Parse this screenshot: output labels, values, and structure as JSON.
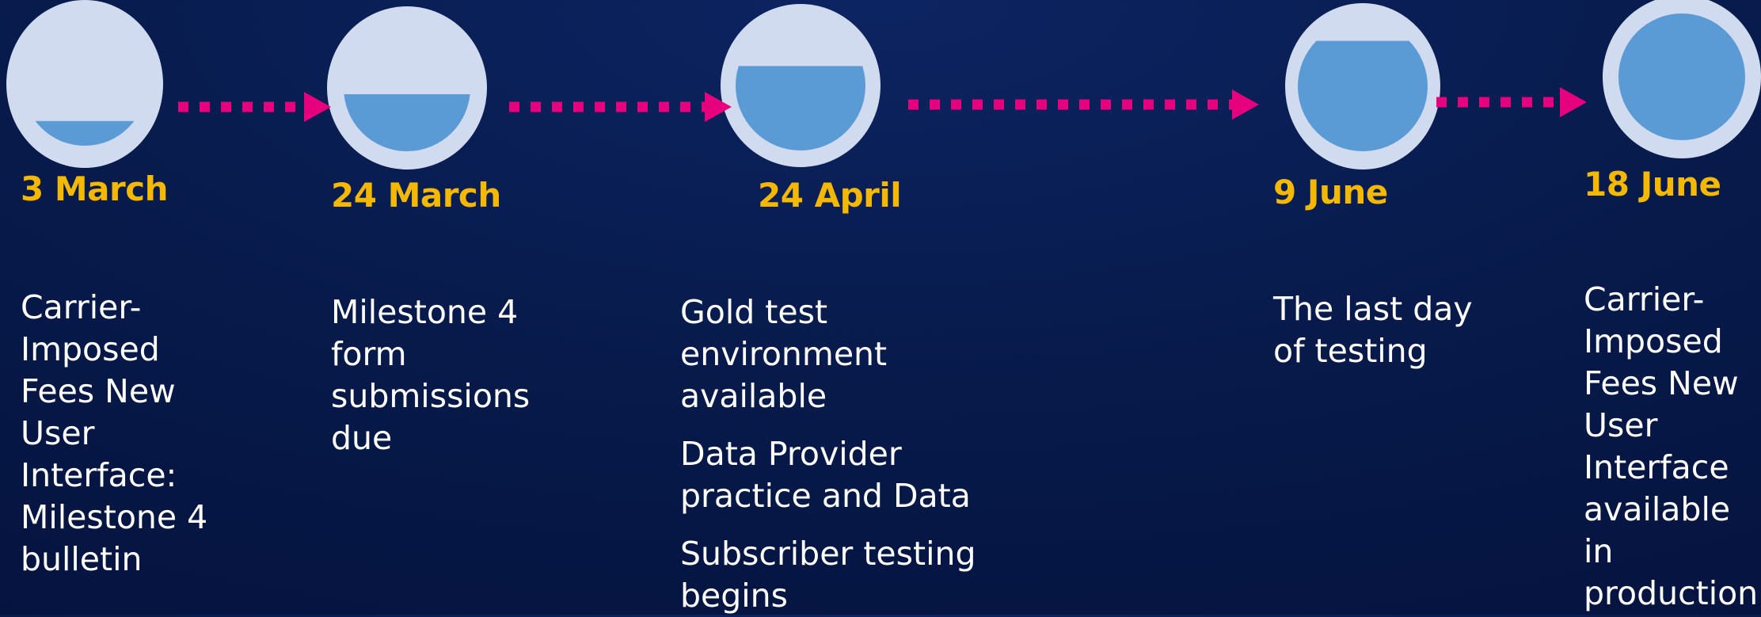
{
  "colors": {
    "background": "#06164a",
    "circle_outer": "#d1dbef",
    "circle_fill": "#5b9bd5",
    "arrow": "#e6007e",
    "date_text": "#f5b800",
    "desc_text": "#ffffff"
  },
  "milestones": [
    {
      "date": "3 March",
      "fill_fraction": 0.2,
      "description": [
        "Carrier-Imposed Fees New User Interface: Milestone 4 bulletin"
      ]
    },
    {
      "date": "24 March",
      "fill_fraction": 0.45,
      "description": [
        "Milestone 4 form submissions due"
      ]
    },
    {
      "date": "24 April",
      "fill_fraction": 0.65,
      "description": [
        "Gold test environment available",
        "Data Provider practice and Data",
        "Subscriber testing begins"
      ]
    },
    {
      "date": "9 June",
      "fill_fraction": 0.85,
      "description": [
        "The last day of testing"
      ]
    },
    {
      "date": "18 June",
      "fill_fraction": 1.0,
      "description": [
        "Carrier-Imposed Fees New User Interface available in production"
      ]
    }
  ]
}
